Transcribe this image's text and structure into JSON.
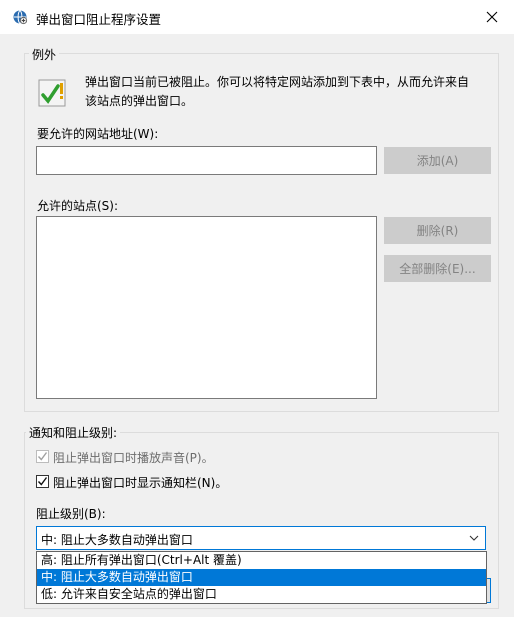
{
  "window": {
    "title": "弹出窗口阻止程序设置"
  },
  "exceptions": {
    "legend": "例外",
    "info_text_line1": "弹出窗口当前已被阻止。你可以将特定网站添加到下表中，从而允许来自",
    "info_text_line2": "该站点的弹出窗口。",
    "address_label": "要允许的网站地址(W):",
    "address_value": "",
    "add_button": "添加(A)",
    "allowed_label": "允许的站点(S):",
    "allowed_sites": [],
    "remove_button": "删除(R)",
    "remove_all_button": "全部删除(E)..."
  },
  "notifications": {
    "legend": "通知和阻止级别:",
    "play_sound_label": "阻止弹出窗口时播放声音(P)。",
    "play_sound_checked": true,
    "play_sound_enabled": false,
    "show_bar_label": "阻止弹出窗口时显示通知栏(N)。",
    "show_bar_checked": true,
    "level_label": "阻止级别(B):",
    "level_selected": "中: 阻止大多数自动弹出窗口",
    "level_options": [
      "高: 阻止所有弹出窗口(Ctrl+Alt 覆盖)",
      "中: 阻止大多数自动弹出窗口",
      "低: 允许来自安全站点的弹出窗口"
    ]
  },
  "colors": {
    "accent": "#0078d7",
    "disabled_button": "#cccccc",
    "disabled_text": "#838383"
  }
}
